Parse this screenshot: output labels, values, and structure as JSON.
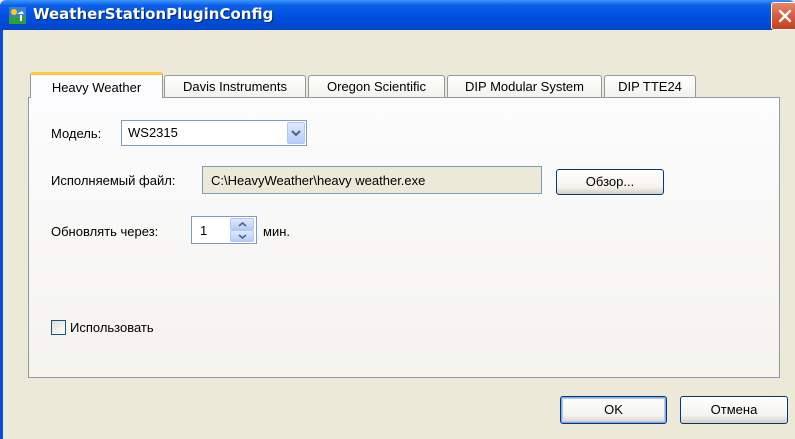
{
  "window": {
    "title": "WeatherStationPluginConfig",
    "icon": "weather-station-icon",
    "close_icon": "close-icon"
  },
  "tabs": [
    {
      "label": "Heavy Weather",
      "active": true
    },
    {
      "label": "Davis Instruments",
      "active": false
    },
    {
      "label": "Oregon Scientific",
      "active": false
    },
    {
      "label": "DIP Modular System",
      "active": false
    },
    {
      "label": "DIP TTE24",
      "active": false
    }
  ],
  "form": {
    "model_label": "Модель:",
    "model_value": "WS2315",
    "exe_label": "Исполняемый файл:",
    "exe_value": "C:\\HeavyWeather\\heavy weather.exe",
    "browse_label": "Обзор...",
    "update_label": "Обновлять через:",
    "update_value": "1",
    "update_unit": "мин.",
    "use_label": "Использовать",
    "use_checked": false
  },
  "buttons": {
    "ok": "OK",
    "cancel": "Отмена"
  },
  "colors": {
    "titlebar": "#0050e0",
    "tab_accent": "#ffc83c",
    "window_bg": "#ece9d8"
  }
}
